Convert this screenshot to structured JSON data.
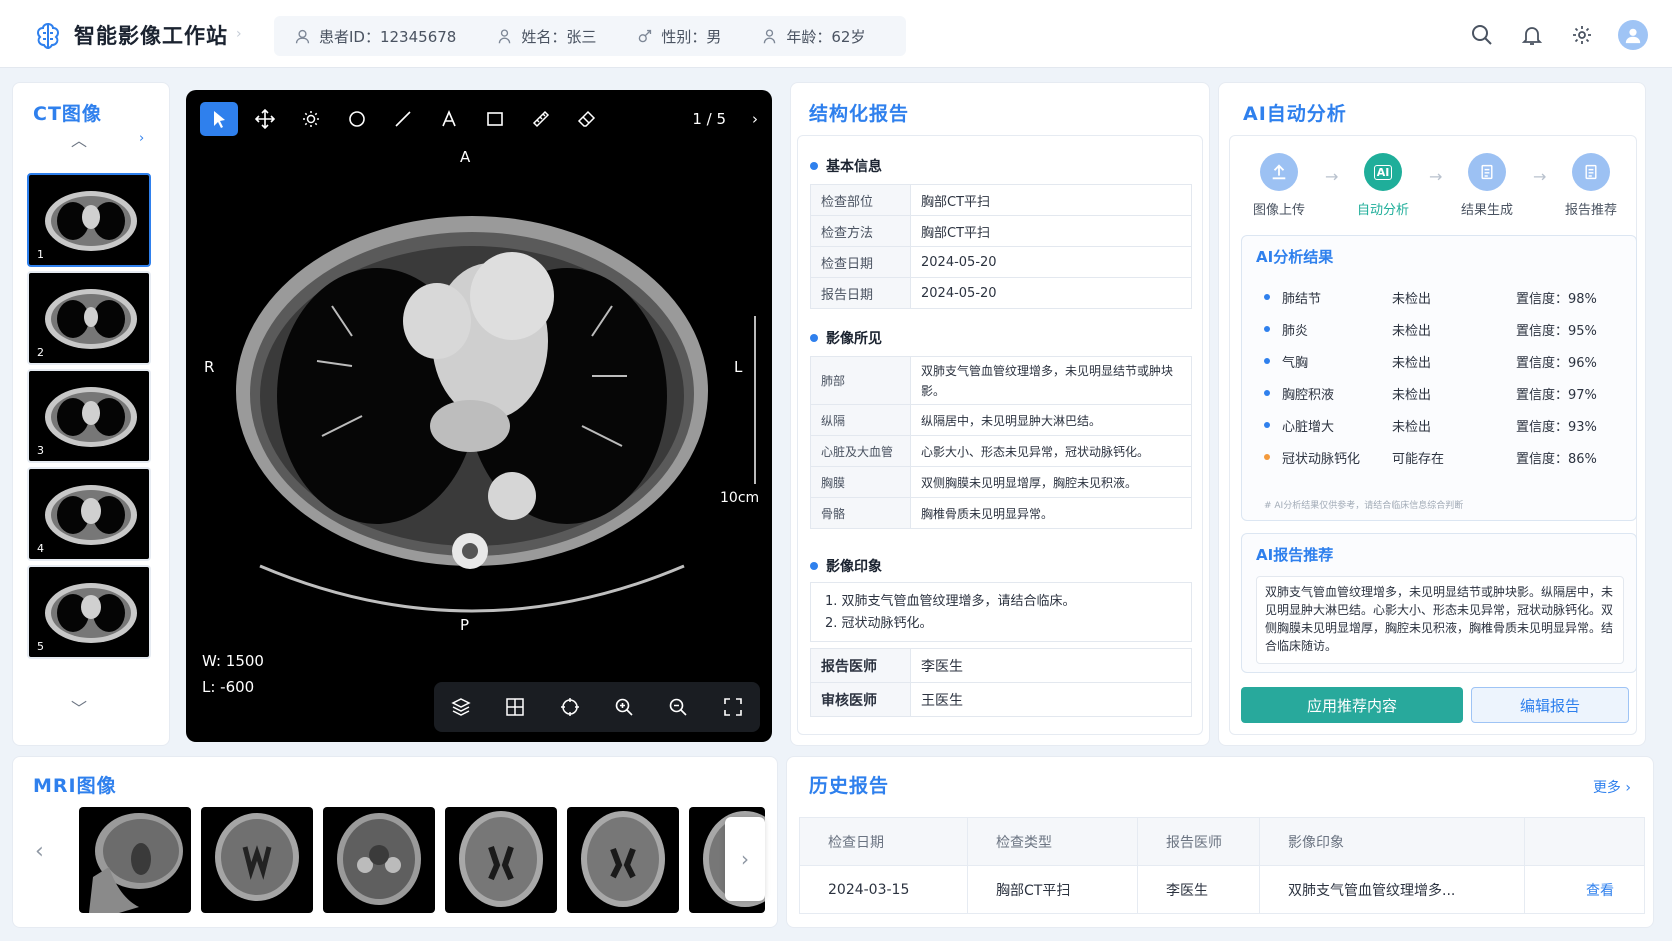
{
  "app": {
    "title": "智能影像工作站",
    "crumb": "›"
  },
  "patient": {
    "id": "患者ID：12345678",
    "name": "姓名：张三",
    "gender": "性别：男",
    "age": "年龄：62岁"
  },
  "icons": {
    "search": "search-icon",
    "bell": "bell-icon",
    "gear": "gear-icon",
    "user": "user-icon"
  },
  "ct": {
    "title": "CT图像",
    "thumbs": [
      "1",
      "2",
      "3",
      "4",
      "5"
    ]
  },
  "viewer": {
    "page": "1 / 5",
    "next": "›",
    "labels": {
      "top": "A",
      "bottom": "P",
      "left": "R",
      "right": "L"
    },
    "scale": "10cm",
    "window": "W:  1500",
    "level": "L:  -600"
  },
  "report": {
    "title": "结构化报告",
    "basic_h": "基本信息",
    "basic": [
      {
        "k": "检查部位",
        "v": "胸部CT平扫"
      },
      {
        "k": "检查方法",
        "v": "胸部CT平扫"
      },
      {
        "k": "检查日期",
        "v": "2024-05-20"
      },
      {
        "k": "报告日期",
        "v": "2024-05-20"
      }
    ],
    "findings_h": "影像所见",
    "findings": [
      {
        "k": "肺部",
        "v": "双肺支气管血管纹理增多，未见明显结节或肿块影。"
      },
      {
        "k": "纵隔",
        "v": "纵隔居中，未见明显肿大淋巴结。"
      },
      {
        "k": "心脏及大血管",
        "v": "心影大小、形态未见异常，冠状动脉钙化。"
      },
      {
        "k": "胸膜",
        "v": "双侧胸膜未见明显增厚，胸腔未见积液。"
      },
      {
        "k": "骨骼",
        "v": "胸椎骨质未见明显异常。"
      }
    ],
    "impression_h": "影像印象",
    "impression": [
      "1. 双肺支气管血管纹理增多，请结合临床。",
      "2. 冠状动脉钙化。"
    ],
    "doctors": [
      {
        "k": "报告医师",
        "v": "李医生"
      },
      {
        "k": "审核医师",
        "v": "王医生"
      }
    ]
  },
  "ai": {
    "title": "AI自动分析",
    "steps": [
      "图像上传",
      "自动分析",
      "结果生成",
      "报告推荐"
    ],
    "step_ai_glyph": "AI",
    "result_h": "AI分析结果",
    "results": [
      {
        "name": "肺结节",
        "status": "未检出",
        "conf": "置信度：98%"
      },
      {
        "name": "肺炎",
        "status": "未检出",
        "conf": "置信度：95%"
      },
      {
        "name": "气胸",
        "status": "未检出",
        "conf": "置信度：96%"
      },
      {
        "name": "胸腔积液",
        "status": "未检出",
        "conf": "置信度：97%"
      },
      {
        "name": "心脏增大",
        "status": "未检出",
        "conf": "置信度：93%"
      },
      {
        "name": "冠状动脉钙化",
        "status": "可能存在",
        "conf": "置信度：86%"
      }
    ],
    "note": "# AI分析结果仅供参考，请结合临床信息综合判断",
    "rec_h": "AI报告推荐",
    "rec_text": "双肺支气管血管纹理增多，未见明显结节或肿块影。纵隔居中，未见明显肿大淋巴结。心影大小、形态未见异常，冠状动脉钙化。双侧胸膜未见明显增厚，胸腔未见积液，胸椎骨质未见明显异常。结合临床随访。",
    "apply": "应用推荐内容",
    "edit": "编辑报告"
  },
  "mri": {
    "title": "MRI图像",
    "prev": "‹",
    "next": "›"
  },
  "history": {
    "title": "历史报告",
    "more": "更多 ›",
    "headers": [
      "检查日期",
      "检查类型",
      "报告医师",
      "影像印象",
      ""
    ],
    "rows": [
      {
        "date": "2024-03-15",
        "type": "胸部CT平扫",
        "doctor": "李医生",
        "impression": "双肺支气管血管纹理增多...",
        "action": "查看"
      }
    ]
  },
  "colors": {
    "accent": "#2f80ed",
    "teal": "#28a99c",
    "warn": "#f39a3d"
  }
}
